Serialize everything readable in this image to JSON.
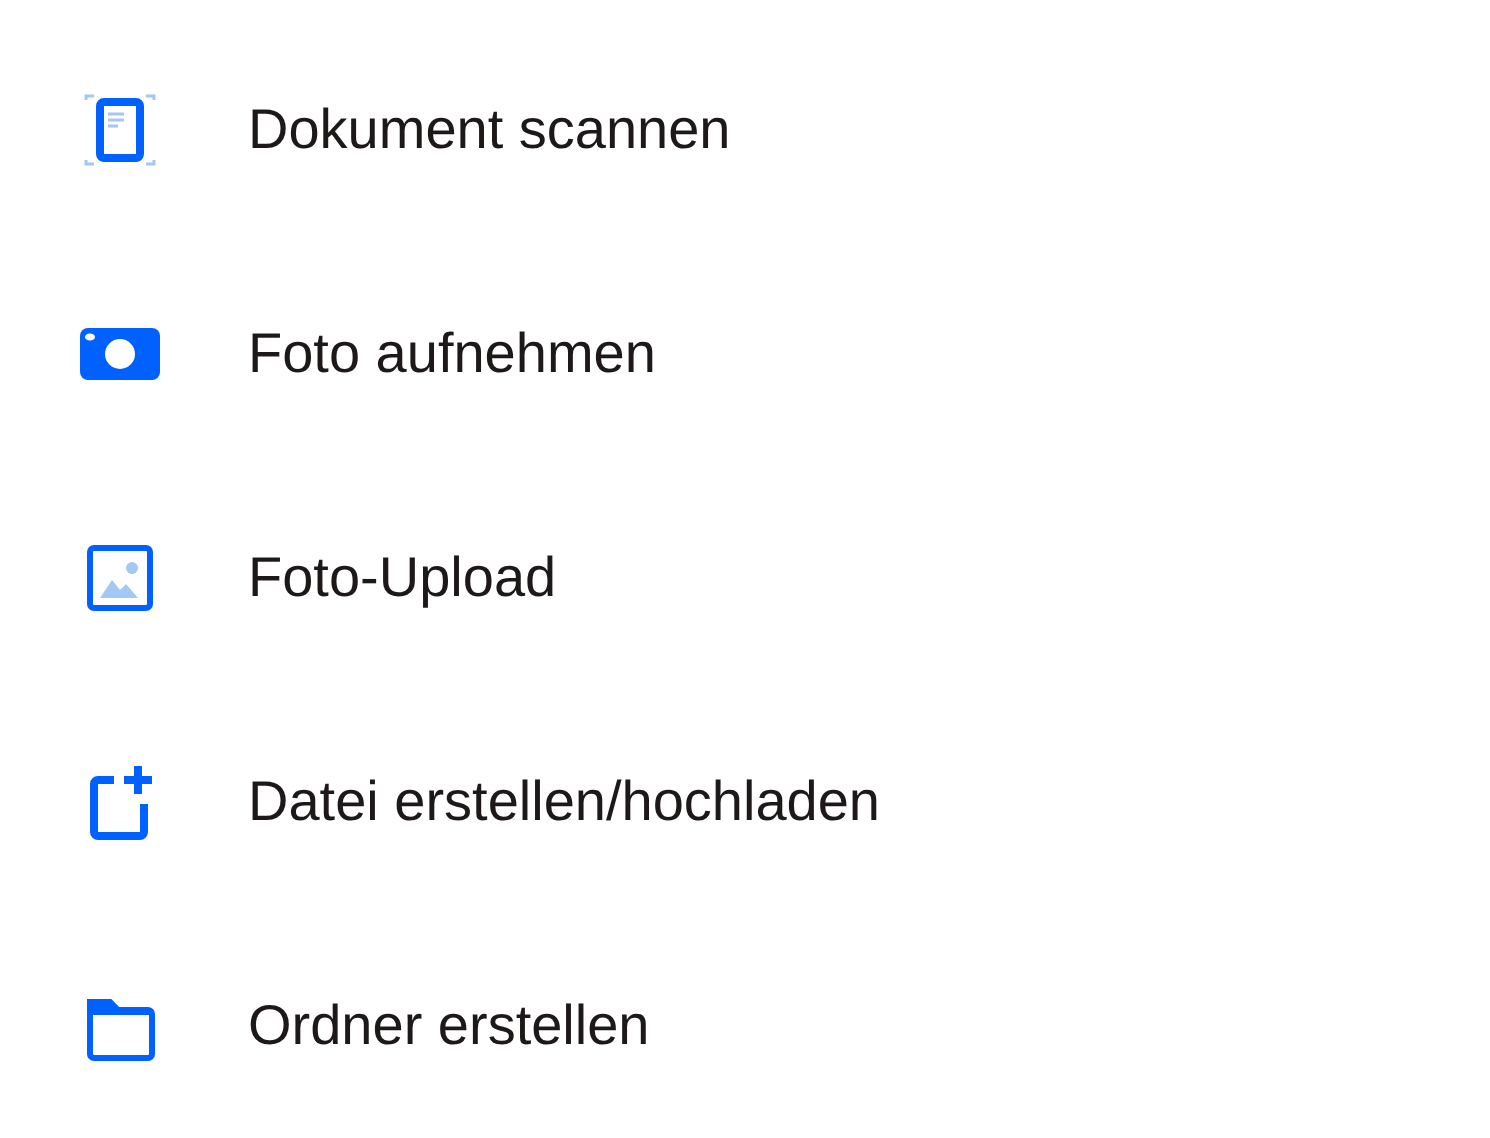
{
  "menu": [
    {
      "kind": "scan",
      "label": "Dokument scannen"
    },
    {
      "kind": "camera",
      "label": "Foto aufnehmen"
    },
    {
      "kind": "image",
      "label": "Foto-Upload"
    },
    {
      "kind": "new-file",
      "label": "Datei erstellen/hochladen"
    },
    {
      "kind": "folder",
      "label": "Ordner erstellen"
    }
  ]
}
